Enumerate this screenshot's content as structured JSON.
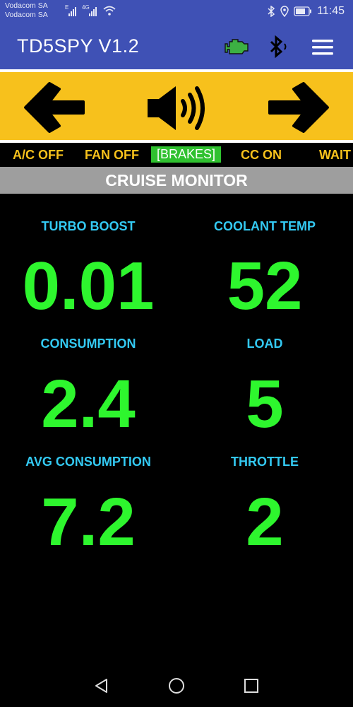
{
  "status_bar": {
    "carrier_1": "Vodacom SA",
    "carrier_2": "Vodacom SA",
    "network_1": "E",
    "network_2": "4G",
    "time": "11:45",
    "icons": [
      "signal-icon",
      "wifi-icon",
      "bluetooth-icon",
      "location-icon",
      "battery-icon"
    ]
  },
  "app_bar": {
    "title": "TD5SPY V1.2",
    "icons": [
      "engine-icon",
      "bluetooth-icon",
      "menu-icon"
    ],
    "colors": {
      "bar": "#3f51b5",
      "engine_icon": "#3cb043"
    }
  },
  "controls": {
    "icons": [
      "arrow-left-icon",
      "speaker-icon",
      "arrow-right-icon"
    ],
    "background": "#f7c11c"
  },
  "indicators": {
    "ac": "A/C OFF",
    "fan": "FAN OFF",
    "brakes": "[BRAKES]",
    "cruise": "CC ON",
    "wait": "WAIT"
  },
  "section": {
    "title": "CRUISE MONITOR"
  },
  "gauges": {
    "turbo_boost": {
      "label": "TURBO BOOST",
      "value": "0.01"
    },
    "coolant_temp": {
      "label": "COOLANT TEMP",
      "value": "52"
    },
    "consumption": {
      "label": "CONSUMPTION",
      "value": "2.4"
    },
    "load": {
      "label": "LOAD",
      "value": "5"
    },
    "avg_consumption": {
      "label": "AVG CONSUMPTION",
      "value": "7.2"
    },
    "throttle": {
      "label": "THROTTLE",
      "value": "2"
    },
    "colors": {
      "label": "#33c9f2",
      "value": "#2ef62e"
    }
  },
  "nav_bar": {
    "icons": [
      "back-icon",
      "home-icon",
      "recents-icon"
    ]
  }
}
